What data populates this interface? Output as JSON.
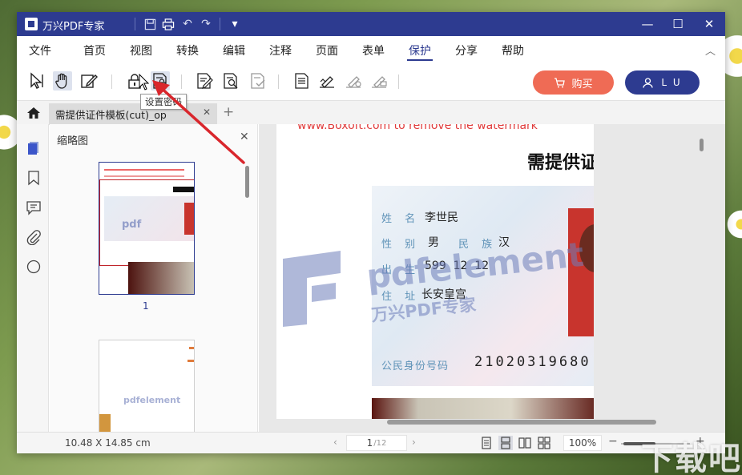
{
  "titlebar": {
    "app_title": "万兴PDF专家"
  },
  "menu": {
    "items": [
      "文件",
      "首页",
      "视图",
      "转换",
      "编辑",
      "注释",
      "页面",
      "表单",
      "保护",
      "分享",
      "帮助"
    ],
    "active": "保护"
  },
  "account": {
    "buy_label": "购买",
    "user_label": "L U"
  },
  "tab": {
    "title": "需提供证件模板(cut)_op"
  },
  "tooltip": {
    "text": "设置密码"
  },
  "thumbnails": {
    "title": "缩略图",
    "page_number": "1"
  },
  "document": {
    "watermark_line": "www.Boxoft.com to remove the watermark",
    "heading": "需提供证",
    "id_card": {
      "name_label": "姓 名",
      "name_value": "李世民",
      "sex_label": "性 别",
      "sex_value": "男",
      "ethnic_label": "民 族",
      "ethnic_value": "汉",
      "birth_label": "出 生",
      "birth_value": "599  12  12",
      "address_label": "住 址",
      "address_value": "长安皇宫",
      "id_label": "公民身份号码",
      "id_value": "21020319680"
    },
    "watermark_brand": "pdfelement",
    "watermark_cn": "万兴PDF专家"
  },
  "statusbar": {
    "page_size": "10.48 X 14.85 cm",
    "current_page": "1",
    "total_pages": "/12",
    "zoom": "100%"
  },
  "colors": {
    "brand": "#2d3b90",
    "buy": "#ef6b55",
    "arrow": "#d9262c"
  }
}
